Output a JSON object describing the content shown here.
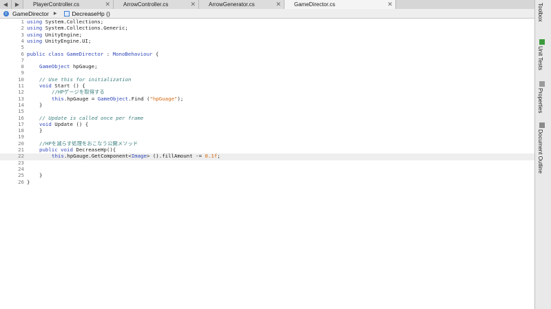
{
  "tabs": [
    {
      "label": "PlayerController.cs",
      "active": false
    },
    {
      "label": "ArrowController.cs",
      "active": false
    },
    {
      "label": "ArrowGenerator.cs",
      "active": false
    },
    {
      "label": "GameDirector.cs",
      "active": true
    }
  ],
  "breadcrumb": {
    "class_name": "GameDirector",
    "method_name": "DecreaseHp ()"
  },
  "code": {
    "line_numbers": [
      "1",
      "2",
      "3",
      "4",
      "5",
      "6",
      "7",
      "8",
      "9",
      "10",
      "11",
      "12",
      "13",
      "14",
      "15",
      "16",
      "17",
      "18",
      "19",
      "20",
      "21",
      "22",
      "23",
      "24",
      "25",
      "26"
    ],
    "current_line": "22",
    "l1": {
      "kw": "using",
      "rest": " System.Collections;"
    },
    "l2": {
      "kw": "using",
      "rest": " System.Collections.Generic;"
    },
    "l3": {
      "kw": "using",
      "rest": " UnityEngine;"
    },
    "l4": {
      "kw": "using",
      "rest": " UnityEngine.UI;"
    },
    "l6": {
      "kw1": "public",
      "kw2": " class ",
      "cls": "GameDirector",
      "colon": " : ",
      "base": "MonoBehaviour",
      "brace": " {"
    },
    "l8": {
      "type": "GameObject",
      "rest": " hpGauge;"
    },
    "l10": {
      "comment": "// Use this for initialization"
    },
    "l11": {
      "kw": "void",
      "rest": " Start () {"
    },
    "l12": {
      "comment": "//HPゲージを取得する"
    },
    "l13": {
      "kw": "this",
      "a": ".hpGauge = ",
      "type": "GameObject",
      "b": ".Find (",
      "str": "\"hpGuage\"",
      "c": ");"
    },
    "l14": {
      "text": "}"
    },
    "l16": {
      "comment": "// Update is called once per frame"
    },
    "l17": {
      "kw": "void",
      "rest": " Update () {"
    },
    "l18": {
      "text": "}"
    },
    "l20": {
      "comment": "//HPを減らす処理をおこなう公開メソッド"
    },
    "l21": {
      "kw1": "public",
      "kw2": " void ",
      "rest": "DecreaseHp(){"
    },
    "l22": {
      "kw": "this",
      "a": ".hpGauge.GetComponent<",
      "type": "Image",
      "b": "> ().fillAmount -= ",
      "num": "0.1f",
      "c": ";"
    },
    "l24": {
      "text": "}"
    },
    "l25": {
      "text": "}"
    }
  },
  "sidebar": {
    "toolbox": "Toolbox",
    "unit_tests": "Unit Tests",
    "properties": "Properties",
    "document_outline": "Document Outline"
  },
  "colors": {
    "keyword": "#2f47b8",
    "comment": "#3e7f7f",
    "string": "#d5690f",
    "accent": "#3f7fd4"
  }
}
